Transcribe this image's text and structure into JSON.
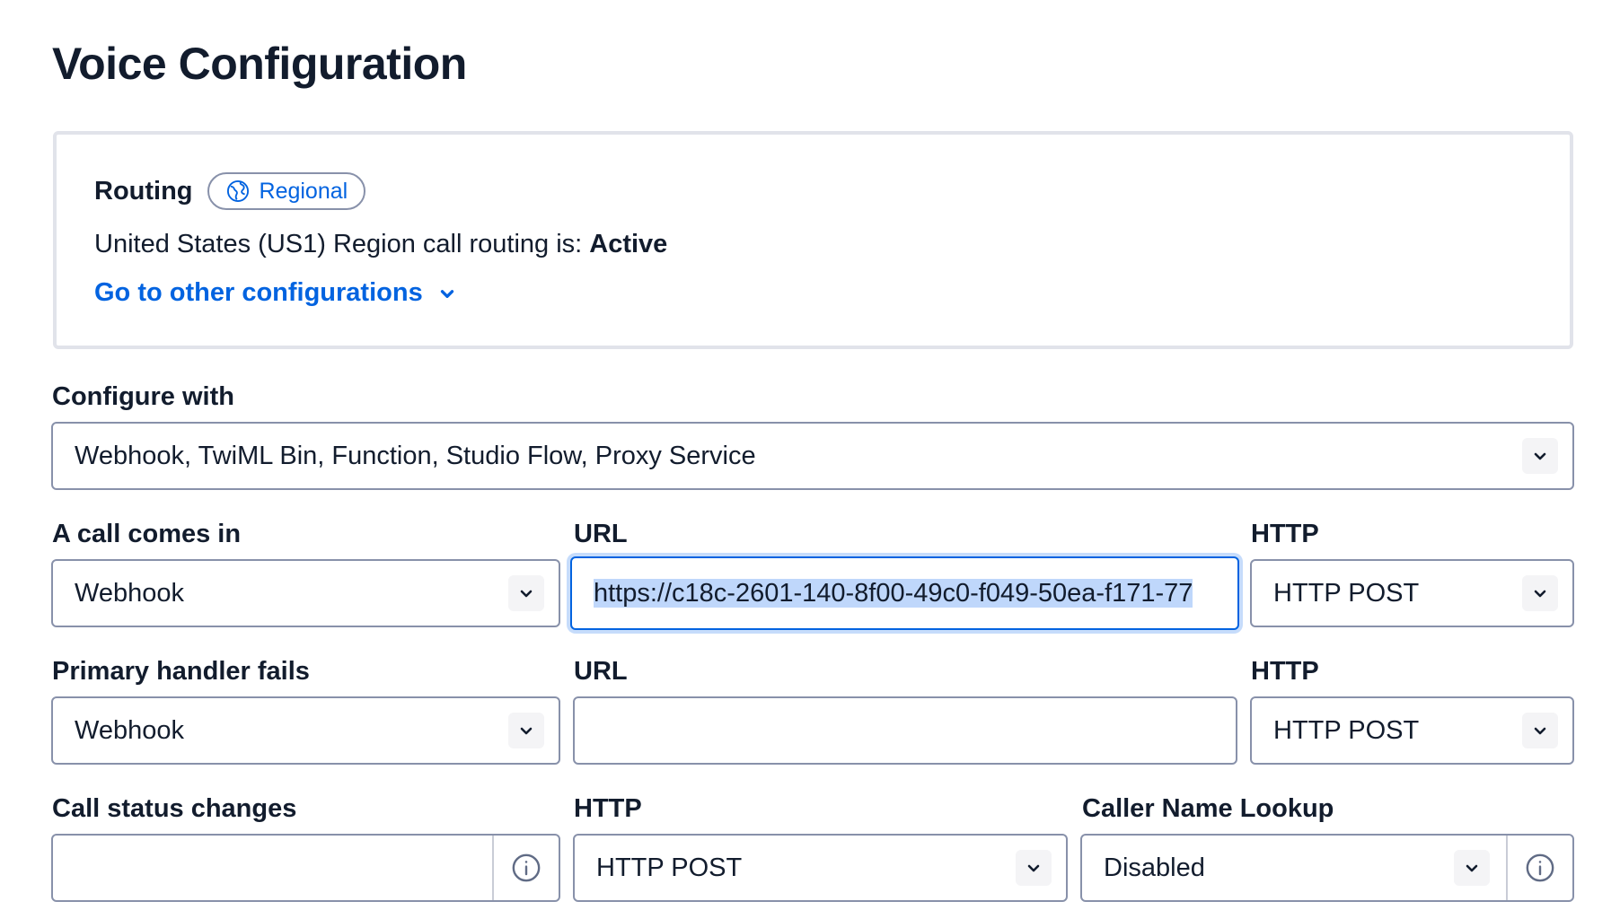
{
  "page_title": "Voice Configuration",
  "routing": {
    "label": "Routing",
    "badge": "Regional",
    "badge_icon": "globe-icon",
    "description_prefix": "United States (US1) Region call routing is:",
    "status": "Active",
    "other_configs_link": "Go to other configurations"
  },
  "configure_with": {
    "label": "Configure with",
    "value": "Webhook, TwiML Bin, Function, Studio Flow, Proxy Service"
  },
  "call_comes_in": {
    "label": "A call comes in",
    "type_value": "Webhook",
    "url_label": "URL",
    "url_value": "https://c18c-2601-140-8f00-49c0-f049-50ea-f171-77",
    "http_label": "HTTP",
    "http_value": "HTTP POST"
  },
  "primary_handler_fails": {
    "label": "Primary handler fails",
    "type_value": "Webhook",
    "url_label": "URL",
    "url_value": "",
    "http_label": "HTTP",
    "http_value": "HTTP POST"
  },
  "call_status_changes": {
    "label": "Call status changes",
    "url_value": "",
    "http_label": "HTTP",
    "http_value": "HTTP POST"
  },
  "caller_name_lookup": {
    "label": "Caller Name Lookup",
    "value": "Disabled"
  },
  "colors": {
    "accent": "#0263e0",
    "text": "#121c2d",
    "border": "#8891aa",
    "selection": "#bfd7fb"
  }
}
